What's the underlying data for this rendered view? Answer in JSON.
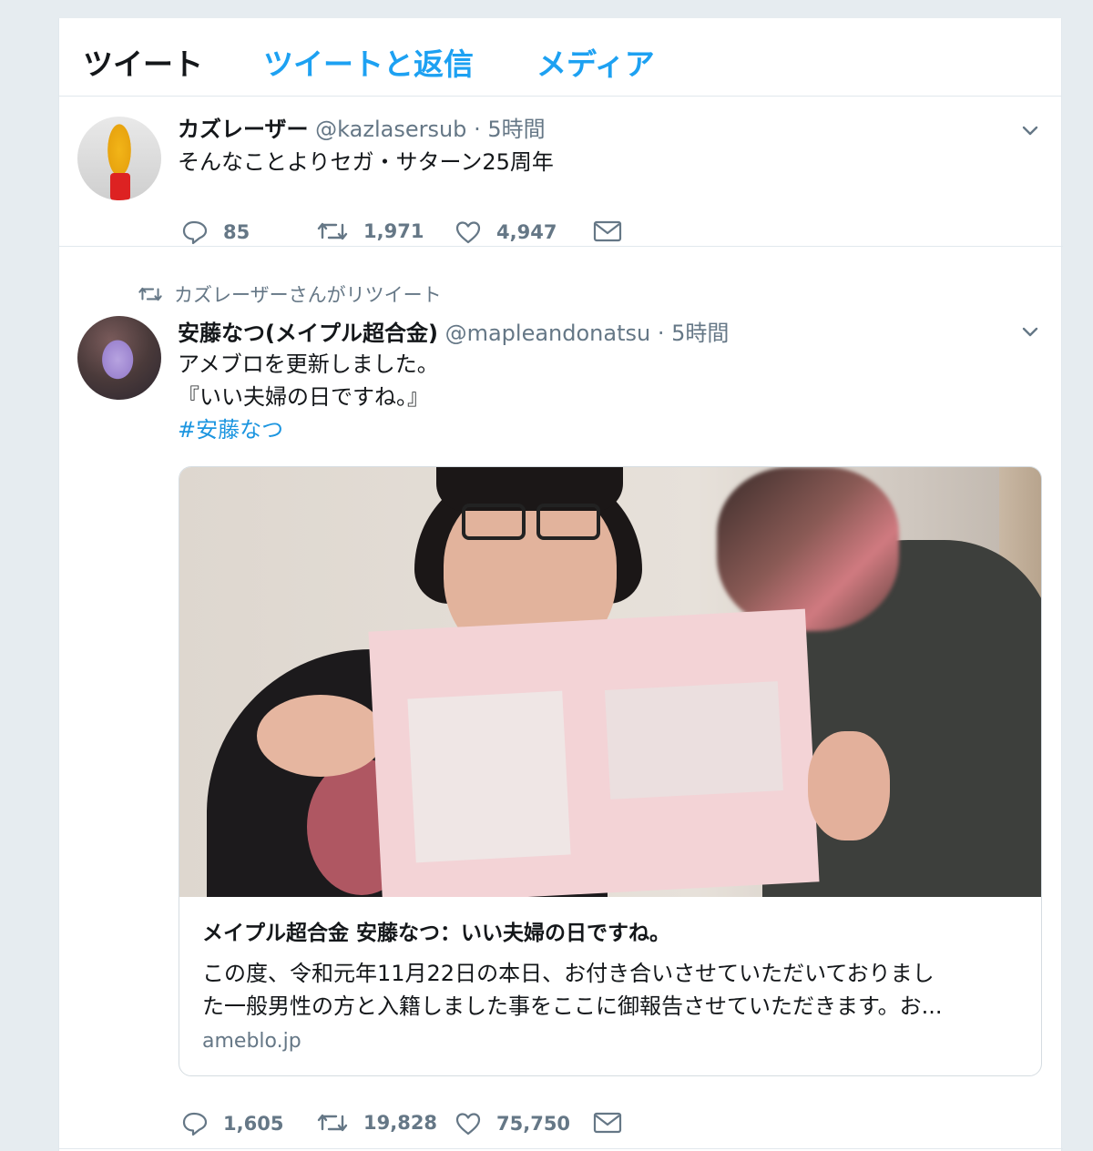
{
  "tabs": [
    {
      "label": "ツイート"
    },
    {
      "label": "ツイートと返信"
    },
    {
      "label": "メディア"
    }
  ],
  "tweets": [
    {
      "name": "カズレーザー",
      "handle": "@kazlasersub",
      "dot": "·",
      "time": "5時間",
      "text": "そんなことよりセガ・サターン25周年",
      "actions": {
        "replies": "85",
        "retweets": "1,971",
        "likes": "4,947"
      }
    },
    {
      "retweet_context": "カズレーザーさんがリツイート",
      "name": "安藤なつ(メイプル超合金)",
      "handle": "@mapleandonatsu",
      "dot": "·",
      "time": "5時間",
      "text_lines": [
        "アメブロを更新しました。",
        "『いい夫婦の日ですね。』"
      ],
      "hashtag": "#安藤なつ",
      "card": {
        "title": "メイプル超合金 安藤なつ：いい夫婦の日ですね。",
        "desc_lines": [
          "この度、令和元年11月22日の本日、お付き合いさせていただいておりまし",
          "た一般男性の方と入籍しました事をここに御報告させていただきます。お..."
        ],
        "domain": "ameblo.jp"
      },
      "actions": {
        "replies": "1,605",
        "retweets": "19,828",
        "likes": "75,750"
      }
    }
  ],
  "icons": {
    "reply": "reply-icon",
    "retweet": "retweet-icon",
    "like": "heart-icon",
    "dm": "envelope-icon",
    "caret": "chevron-down-icon"
  },
  "colors": {
    "accent": "#1da1f2",
    "muted": "#657786",
    "text": "#14171a",
    "background": "#e6ecf0"
  }
}
